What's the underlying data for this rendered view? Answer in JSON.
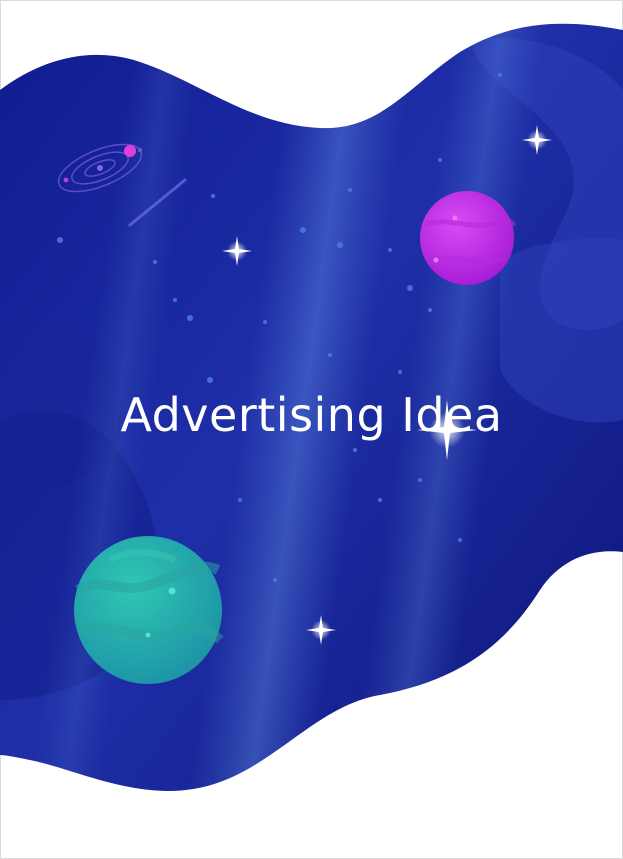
{
  "poster": {
    "title": "Advertising Idea"
  },
  "colors": {
    "background": "#ffffff",
    "space_dark": "#0e1580",
    "space_mid": "#1d2aa6",
    "space_light": "#3a55c8",
    "planet_magenta": "#c21fe6",
    "planet_teal": "#1fb3a6",
    "star": "#ffffff"
  },
  "icons": [
    "spiral-galaxy-icon",
    "comet-icon",
    "star-sparkle-icon",
    "magenta-planet-icon",
    "teal-planet-icon"
  ]
}
